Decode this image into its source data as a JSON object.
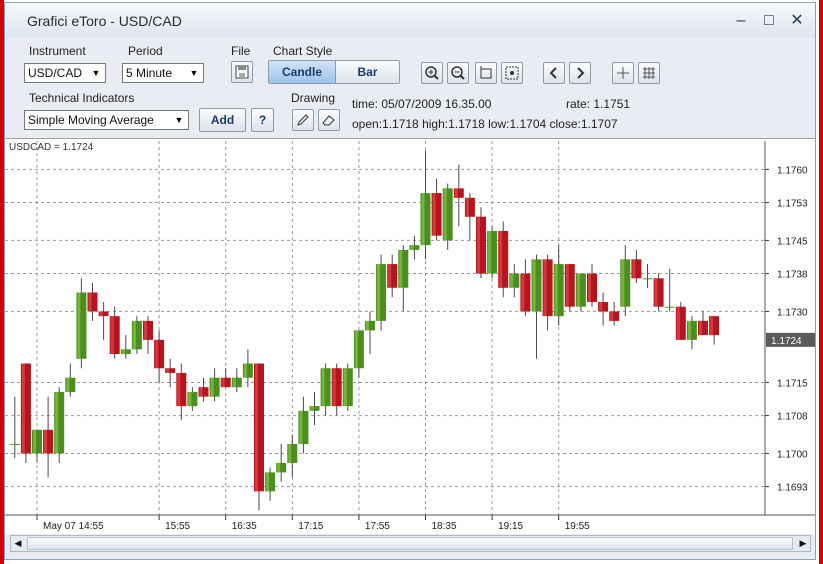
{
  "window": {
    "title": "Grafici eToro - USD/CAD",
    "minimize_icon": "minimize-icon",
    "maximize_icon": "maximize-icon",
    "close_icon": "close-icon"
  },
  "toolbar": {
    "instrument_label": "Instrument",
    "instrument_value": "USD/CAD",
    "period_label": "Period",
    "period_value": "5 Minute",
    "file_label": "File",
    "chart_style_label": "Chart Style",
    "candle_label": "Candle",
    "bar_label": "Bar",
    "indicators_label": "Technical Indicators",
    "indicator_value": "Simple Moving Average",
    "add_label": "Add",
    "help_label": "?",
    "drawing_label": "Drawing",
    "icons": [
      "save-icon",
      "zoom-in-icon",
      "zoom-out-icon",
      "crop-icon",
      "fit-icon",
      "scroll-left-icon",
      "scroll-right-icon",
      "crosshair-icon",
      "grid-icon",
      "pencil-icon",
      "eraser-icon"
    ]
  },
  "info": {
    "time": "time: 05/07/2009 16.35.00",
    "rate": "rate: 1.1751",
    "ohlc": "open:1.1718  high:1.1718  low:1.1704  close:1.1707"
  },
  "chart_data": {
    "type": "candlestick",
    "label": "USDCAD = 1.1724",
    "current_price": 1.1724,
    "current_price_label": "1.1724",
    "ylim": [
      1.1687,
      1.1766
    ],
    "y_ticks": [
      1.176,
      1.1753,
      1.1745,
      1.1738,
      1.173,
      1.1715,
      1.1708,
      1.17,
      1.1693
    ],
    "y_tick_labels": [
      "1.1760",
      "1.1753",
      "1.1745",
      "1.1738",
      "1.1730",
      "1.1715",
      "1.1708",
      "1.1700",
      "1.1693"
    ],
    "x_ticks": [
      0,
      11,
      17,
      23,
      29,
      35,
      41,
      47
    ],
    "x_tick_labels": [
      "May 07 14:55",
      "15:55",
      "16:35",
      "17:15",
      "17:55",
      "18:35",
      "19:15",
      "19:55"
    ],
    "grid": true,
    "up_color": "#4a8f1f",
    "down_color": "#b5161d",
    "candles": [
      {
        "i": -2,
        "o": 1.1702,
        "h": 1.1712,
        "l": 1.1699,
        "c": 1.1702
      },
      {
        "i": -1,
        "o": 1.1719,
        "h": 1.1719,
        "l": 1.1698,
        "c": 1.17
      },
      {
        "i": 0,
        "o": 1.17,
        "h": 1.1705,
        "l": 1.1698,
        "c": 1.1705
      },
      {
        "i": 1,
        "o": 1.1705,
        "h": 1.1712,
        "l": 1.1695,
        "c": 1.17
      },
      {
        "i": 2,
        "o": 1.17,
        "h": 1.1714,
        "l": 1.1698,
        "c": 1.1713
      },
      {
        "i": 3,
        "o": 1.1713,
        "h": 1.1719,
        "l": 1.1712,
        "c": 1.1716
      },
      {
        "i": 4,
        "o": 1.172,
        "h": 1.1737,
        "l": 1.1718,
        "c": 1.1734
      },
      {
        "i": 5,
        "o": 1.1734,
        "h": 1.1736,
        "l": 1.1728,
        "c": 1.173
      },
      {
        "i": 6,
        "o": 1.173,
        "h": 1.1732,
        "l": 1.1724,
        "c": 1.1729
      },
      {
        "i": 7,
        "o": 1.1729,
        "h": 1.1731,
        "l": 1.172,
        "c": 1.1721
      },
      {
        "i": 8,
        "o": 1.1721,
        "h": 1.1725,
        "l": 1.172,
        "c": 1.1722
      },
      {
        "i": 9,
        "o": 1.1722,
        "h": 1.1729,
        "l": 1.1721,
        "c": 1.1728
      },
      {
        "i": 10,
        "o": 1.1728,
        "h": 1.1729,
        "l": 1.1721,
        "c": 1.1724
      },
      {
        "i": 11,
        "o": 1.1724,
        "h": 1.1726,
        "l": 1.1715,
        "c": 1.1718
      },
      {
        "i": 12,
        "o": 1.1718,
        "h": 1.172,
        "l": 1.1714,
        "c": 1.1717
      },
      {
        "i": 13,
        "o": 1.1717,
        "h": 1.1719,
        "l": 1.1707,
        "c": 1.171
      },
      {
        "i": 14,
        "o": 1.171,
        "h": 1.1714,
        "l": 1.1709,
        "c": 1.1713
      },
      {
        "i": 15,
        "o": 1.1714,
        "h": 1.1716,
        "l": 1.1711,
        "c": 1.1712
      },
      {
        "i": 16,
        "o": 1.1712,
        "h": 1.1718,
        "l": 1.1711,
        "c": 1.1716
      },
      {
        "i": 17,
        "o": 1.1716,
        "h": 1.1718,
        "l": 1.1714,
        "c": 1.1714
      },
      {
        "i": 18,
        "o": 1.1714,
        "h": 1.1718,
        "l": 1.1713,
        "c": 1.1716
      },
      {
        "i": 19,
        "o": 1.1716,
        "h": 1.1722,
        "l": 1.1714,
        "c": 1.1719
      },
      {
        "i": 20,
        "o": 1.1719,
        "h": 1.1719,
        "l": 1.1688,
        "c": 1.1692
      },
      {
        "i": 21,
        "o": 1.1692,
        "h": 1.1697,
        "l": 1.169,
        "c": 1.1696
      },
      {
        "i": 22,
        "o": 1.1696,
        "h": 1.1702,
        "l": 1.1694,
        "c": 1.1698
      },
      {
        "i": 23,
        "o": 1.1698,
        "h": 1.1704,
        "l": 1.1695,
        "c": 1.1702
      },
      {
        "i": 24,
        "o": 1.1702,
        "h": 1.1712,
        "l": 1.17,
        "c": 1.1709
      },
      {
        "i": 25,
        "o": 1.1709,
        "h": 1.1713,
        "l": 1.1706,
        "c": 1.171
      },
      {
        "i": 26,
        "o": 1.171,
        "h": 1.1719,
        "l": 1.1708,
        "c": 1.1718
      },
      {
        "i": 27,
        "o": 1.1718,
        "h": 1.1719,
        "l": 1.1708,
        "c": 1.171
      },
      {
        "i": 28,
        "o": 1.171,
        "h": 1.1719,
        "l": 1.1709,
        "c": 1.1718
      },
      {
        "i": 29,
        "o": 1.1718,
        "h": 1.1726,
        "l": 1.1716,
        "c": 1.1726
      },
      {
        "i": 30,
        "o": 1.1726,
        "h": 1.173,
        "l": 1.1721,
        "c": 1.1728
      },
      {
        "i": 31,
        "o": 1.1728,
        "h": 1.1742,
        "l": 1.1726,
        "c": 1.174
      },
      {
        "i": 32,
        "o": 1.174,
        "h": 1.1742,
        "l": 1.1733,
        "c": 1.1735
      },
      {
        "i": 33,
        "o": 1.1735,
        "h": 1.1744,
        "l": 1.173,
        "c": 1.1743
      },
      {
        "i": 34,
        "o": 1.1743,
        "h": 1.1746,
        "l": 1.1741,
        "c": 1.1744
      },
      {
        "i": 35,
        "o": 1.1744,
        "h": 1.1764,
        "l": 1.1741,
        "c": 1.1755
      },
      {
        "i": 36,
        "o": 1.1755,
        "h": 1.1758,
        "l": 1.1745,
        "c": 1.1746
      },
      {
        "i": 37,
        "o": 1.1745,
        "h": 1.1757,
        "l": 1.1743,
        "c": 1.1756
      },
      {
        "i": 38,
        "o": 1.1756,
        "h": 1.1761,
        "l": 1.1748,
        "c": 1.1754
      },
      {
        "i": 39,
        "o": 1.1754,
        "h": 1.1755,
        "l": 1.1745,
        "c": 1.175
      },
      {
        "i": 40,
        "o": 1.175,
        "h": 1.1752,
        "l": 1.1737,
        "c": 1.1738
      },
      {
        "i": 41,
        "o": 1.1738,
        "h": 1.1748,
        "l": 1.1737,
        "c": 1.1747
      },
      {
        "i": 42,
        "o": 1.1747,
        "h": 1.1749,
        "l": 1.1733,
        "c": 1.1735
      },
      {
        "i": 43,
        "o": 1.1735,
        "h": 1.174,
        "l": 1.1733,
        "c": 1.1738
      },
      {
        "i": 44,
        "o": 1.1738,
        "h": 1.1741,
        "l": 1.1729,
        "c": 1.173
      },
      {
        "i": 45,
        "o": 1.173,
        "h": 1.1742,
        "l": 1.172,
        "c": 1.1741
      },
      {
        "i": 46,
        "o": 1.1741,
        "h": 1.1742,
        "l": 1.1726,
        "c": 1.1729
      },
      {
        "i": 47,
        "o": 1.1729,
        "h": 1.1744,
        "l": 1.1727,
        "c": 1.174
      },
      {
        "i": 48,
        "o": 1.174,
        "h": 1.174,
        "l": 1.173,
        "c": 1.1731
      },
      {
        "i": 49,
        "o": 1.1731,
        "h": 1.1738,
        "l": 1.173,
        "c": 1.1738
      },
      {
        "i": 50,
        "o": 1.1738,
        "h": 1.174,
        "l": 1.1731,
        "c": 1.1732
      },
      {
        "i": 51,
        "o": 1.1732,
        "h": 1.1734,
        "l": 1.1727,
        "c": 1.173
      },
      {
        "i": 52,
        "o": 1.173,
        "h": 1.1732,
        "l": 1.1727,
        "c": 1.1728
      },
      {
        "i": 53,
        "o": 1.1731,
        "h": 1.1744,
        "l": 1.1729,
        "c": 1.1741
      },
      {
        "i": 54,
        "o": 1.1741,
        "h": 1.1743,
        "l": 1.1736,
        "c": 1.1737
      },
      {
        "i": 55,
        "o": 1.1737,
        "h": 1.174,
        "l": 1.1735,
        "c": 1.1737
      },
      {
        "i": 56,
        "o": 1.1737,
        "h": 1.1738,
        "l": 1.173,
        "c": 1.1731
      },
      {
        "i": 57,
        "o": 1.1731,
        "h": 1.1739,
        "l": 1.173,
        "c": 1.1731
      },
      {
        "i": 58,
        "o": 1.1731,
        "h": 1.1732,
        "l": 1.1724,
        "c": 1.1724
      },
      {
        "i": 59,
        "o": 1.1724,
        "h": 1.1729,
        "l": 1.1722,
        "c": 1.1728
      },
      {
        "i": 60,
        "o": 1.1728,
        "h": 1.173,
        "l": 1.1725,
        "c": 1.1725
      },
      {
        "i": 61,
        "o": 1.1729,
        "h": 1.1729,
        "l": 1.1723,
        "c": 1.1725
      }
    ]
  }
}
